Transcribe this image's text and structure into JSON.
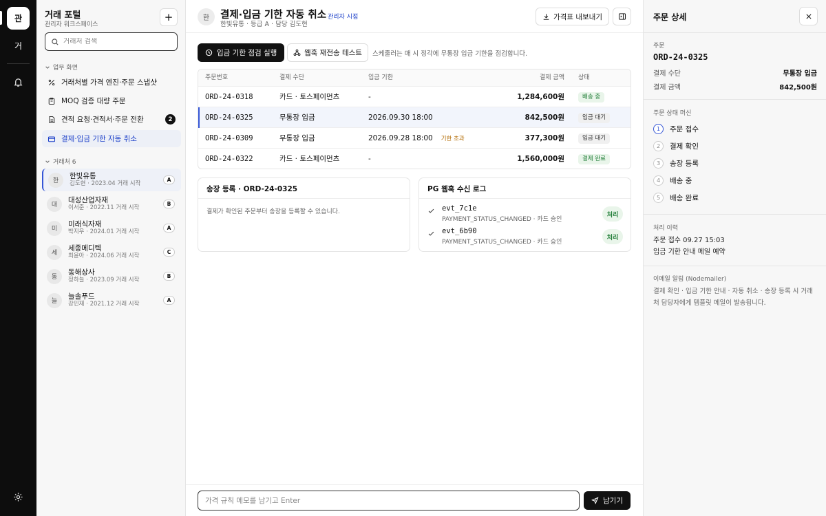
{
  "rail": {
    "avatar1": "관",
    "avatar2": "거"
  },
  "sidebar": {
    "title": "거래 포털",
    "subtitle": "관리자 워크스페이스",
    "search_placeholder": "거래처 검색",
    "section_work": "업무 화면",
    "nav": [
      {
        "label": "거래처별 가격 엔진·주문 스냅샷"
      },
      {
        "label": "MOQ 검증 대량 주문"
      },
      {
        "label": "견적 요청·견적서·주문 전환",
        "badge": "2"
      },
      {
        "label": "결제·입금 기한 자동 취소"
      }
    ],
    "section_customers": "거래처 6",
    "customers": [
      {
        "initial": "한",
        "name": "한빛유통",
        "meta": "김도현 · 2023.04 거래 시작",
        "grade": "A"
      },
      {
        "initial": "대",
        "name": "대성산업자재",
        "meta": "이서준 · 2022.11 거래 시작",
        "grade": "B"
      },
      {
        "initial": "미",
        "name": "미래식자재",
        "meta": "박지우 · 2024.01 거래 시작",
        "grade": "A"
      },
      {
        "initial": "세",
        "name": "세종메디텍",
        "meta": "최윤아 · 2024.06 거래 시작",
        "grade": "C"
      },
      {
        "initial": "동",
        "name": "동해상사",
        "meta": "정하늘 · 2023.09 거래 시작",
        "grade": "B"
      },
      {
        "initial": "늘",
        "name": "늘솔푸드",
        "meta": "강민재 · 2021.12 거래 시작",
        "grade": "A"
      }
    ]
  },
  "header": {
    "avatar": "한",
    "title": "결제·입금 기한 자동 취소",
    "tag": "관리자 시점",
    "subtitle": "한빛유통 · 등급 A · 담당 김도현",
    "export_label": "가격표 내보내기"
  },
  "toolbar": {
    "run_label": "입금 기한 점검 실행",
    "webhook_label": "웹훅 재전송 테스트",
    "note": "스케줄러는 매 시 정각에 무통장 입금 기한을 점검합니다."
  },
  "table": {
    "headers": [
      "주문번호",
      "결제 수단",
      "입금 기한",
      "결제 금액",
      "상태"
    ],
    "rows": [
      {
        "id": "ORD-24-0318",
        "method": "카드 · 토스페이먼츠",
        "deadline": "-",
        "overdue": "",
        "amount": "1,284,600원",
        "status": "배송 중",
        "status_bg": "#e9f5ea",
        "status_fg": "#1e7c35"
      },
      {
        "id": "ORD-24-0325",
        "method": "무통장 입금",
        "deadline": "2026.09.30 18:00",
        "overdue": "",
        "amount": "842,500원",
        "status": "입금 대기",
        "status_bg": "#f0f0f0",
        "status_fg": "#333"
      },
      {
        "id": "ORD-24-0309",
        "method": "무통장 입금",
        "deadline": "2026.09.28 18:00",
        "overdue": "기한 초과",
        "amount": "377,300원",
        "status": "입금 대기",
        "status_bg": "#f0f0f0",
        "status_fg": "#333"
      },
      {
        "id": "ORD-24-0322",
        "method": "카드 · 토스페이먼츠",
        "deadline": "-",
        "overdue": "",
        "amount": "1,560,000원",
        "status": "결제 완료",
        "status_bg": "#e9f5ea",
        "status_fg": "#1e7c35"
      }
    ]
  },
  "invoice_card": {
    "title": "송장 등록 · ORD-24-0325",
    "body": "결제가 확인된 주문부터 송장을 등록할 수 있습니다."
  },
  "webhook_card": {
    "title": "PG 웹훅 수신 로그",
    "logs": [
      {
        "id": "evt_7c1e",
        "desc": "PAYMENT_STATUS_CHANGED · 카드 승인",
        "badge": "처리"
      },
      {
        "id": "evt_6b90",
        "desc": "PAYMENT_STATUS_CHANGED · 카드 승인",
        "badge": "처리"
      }
    ]
  },
  "footer": {
    "memo_placeholder": "가격 규칙 메모를 남기고 Enter",
    "send_label": "남기기"
  },
  "detail": {
    "title": "주문 상세",
    "order_label": "주문",
    "order_id": "ORD-24-0325",
    "method_key": "결제 수단",
    "method_val": "무통장 입금",
    "amount_key": "결제 금액",
    "amount_val": "842,500원",
    "state_label": "주문 상태 머신",
    "steps": [
      {
        "num": "1",
        "label": "주문 접수"
      },
      {
        "num": "2",
        "label": "결제 확인"
      },
      {
        "num": "3",
        "label": "송장 등록"
      },
      {
        "num": "4",
        "label": "배송 중"
      },
      {
        "num": "5",
        "label": "배송 완료"
      }
    ],
    "history_label": "처리 이력",
    "history": [
      "주문 접수 09.27 15:03",
      "입금 기한 안내 메일 예약"
    ],
    "email_label": "이메일 알림 (Nodemailer)",
    "email_note": "결제 확인 · 입금 기한 안내 · 자동 취소 · 송장 등록 시 거래처 담당자에게 템플릿 메일이 발송됩니다."
  }
}
